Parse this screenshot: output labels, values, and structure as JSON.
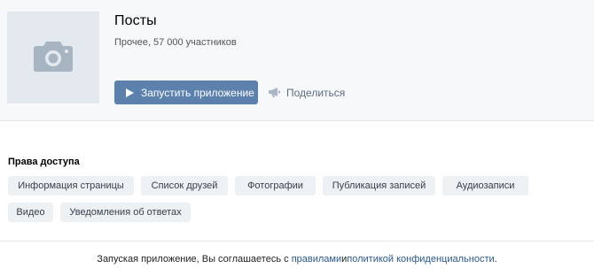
{
  "app": {
    "title": "Посты",
    "meta": "Прочее, 57 000 участников",
    "launch_label": "Запустить приложение",
    "share_label": "Поделиться",
    "cover_icon": "camera-icon"
  },
  "permissions": {
    "title": "Права доступа",
    "items": [
      "Информация страницы",
      "Список друзей",
      "Фотографии",
      "Публикация записей",
      "Аудиозаписи",
      "Видео",
      "Уведомления об ответах"
    ]
  },
  "footer": {
    "prefix": "Запуская приложение, Вы соглашаетесь с ",
    "rules_link": "правилами",
    "conjunction": " и ",
    "privacy_link": "политикой конфиденциальности",
    "suffix": "."
  },
  "colors": {
    "accent": "#5c81ad",
    "link": "#2a5885",
    "chip_bg": "#eef1f4",
    "header_bg": "#f7f8fa"
  }
}
